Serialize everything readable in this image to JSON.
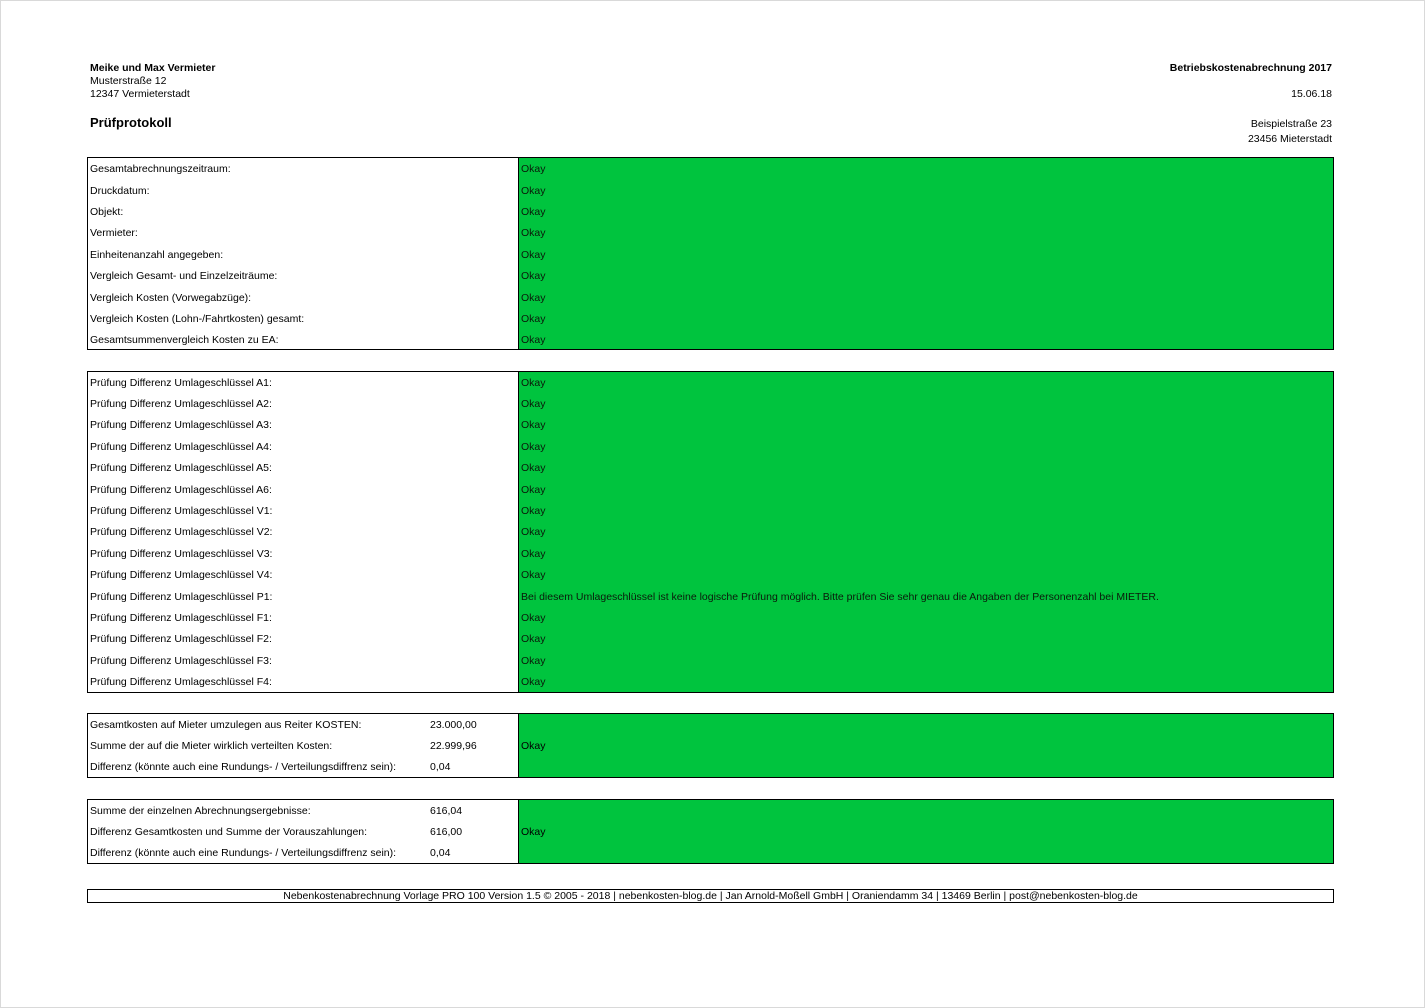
{
  "header": {
    "sender_name": "Meike und Max Vermieter",
    "sender_street": "Musterstraße 12",
    "sender_city": "12347 Vermieterstadt",
    "doc_title": "Betriebskostenabrechnung 2017",
    "doc_date": "15.06.18",
    "heading": "Prüfprotokoll",
    "recipient_street": "Beispielstraße 23",
    "recipient_city": "23456 Mieterstadt"
  },
  "section1": {
    "rows": [
      {
        "label": "Gesamtabrechnungszeitraum:",
        "status": "Okay"
      },
      {
        "label": "Druckdatum:",
        "status": "Okay"
      },
      {
        "label": "Objekt:",
        "status": "Okay"
      },
      {
        "label": "Vermieter:",
        "status": "Okay"
      },
      {
        "label": "Einheitenanzahl angegeben:",
        "status": "Okay"
      },
      {
        "label": "Vergleich Gesamt- und Einzelzeiträume:",
        "status": "Okay"
      },
      {
        "label": "Vergleich Kosten (Vorwegabzüge):",
        "status": "Okay"
      },
      {
        "label": "Vergleich Kosten (Lohn-/Fahrtkosten) gesamt:",
        "status": "Okay"
      },
      {
        "label": "Gesamtsummenvergleich Kosten zu EA:",
        "status": "Okay"
      }
    ]
  },
  "section2": {
    "rows": [
      {
        "label": "Prüfung Differenz Umlageschlüssel A1:",
        "status": "Okay"
      },
      {
        "label": "Prüfung Differenz Umlageschlüssel A2:",
        "status": "Okay"
      },
      {
        "label": "Prüfung Differenz Umlageschlüssel A3:",
        "status": "Okay"
      },
      {
        "label": "Prüfung Differenz Umlageschlüssel A4:",
        "status": "Okay"
      },
      {
        "label": "Prüfung Differenz Umlageschlüssel A5:",
        "status": "Okay"
      },
      {
        "label": "Prüfung Differenz Umlageschlüssel A6:",
        "status": "Okay"
      },
      {
        "label": "Prüfung Differenz Umlageschlüssel V1:",
        "status": "Okay"
      },
      {
        "label": "Prüfung Differenz Umlageschlüssel V2:",
        "status": "Okay"
      },
      {
        "label": "Prüfung Differenz Umlageschlüssel V3:",
        "status": "Okay"
      },
      {
        "label": "Prüfung Differenz Umlageschlüssel V4:",
        "status": "Okay"
      },
      {
        "label": "Prüfung Differenz Umlageschlüssel P1:",
        "status": "Bei diesem Umlageschlüssel ist keine logische Prüfung möglich. Bitte prüfen Sie sehr genau die Angaben der Personenzahl bei MIETER."
      },
      {
        "label": "Prüfung Differenz Umlageschlüssel F1:",
        "status": "Okay"
      },
      {
        "label": "Prüfung Differenz Umlageschlüssel F2:",
        "status": "Okay"
      },
      {
        "label": "Prüfung Differenz Umlageschlüssel F3:",
        "status": "Okay"
      },
      {
        "label": "Prüfung Differenz Umlageschlüssel F4:",
        "status": "Okay"
      }
    ]
  },
  "section3": {
    "rows": [
      {
        "label": "Gesamtkosten auf Mieter umzulegen aus Reiter KOSTEN:",
        "value": "23.000,00"
      },
      {
        "label": "Summe der auf die Mieter wirklich verteilten Kosten:",
        "value": "22.999,96"
      },
      {
        "label": "Differenz (könnte auch eine Rundungs- / Verteilungsdiffrenz sein):",
        "value": "0,04"
      }
    ],
    "status": "Okay"
  },
  "section4": {
    "rows": [
      {
        "label": "Summe der einzelnen Abrechnungsergebnisse:",
        "value": "616,04"
      },
      {
        "label": "Differenz Gesamtkosten und Summe der Vorauszahlungen:",
        "value": "616,00"
      },
      {
        "label": "Differenz (könnte auch eine Rundungs- / Verteilungsdiffrenz sein):",
        "value": "0,04"
      }
    ],
    "status": "Okay"
  },
  "footer": {
    "text": "Nebenkostenabrechnung Vorlage PRO 100 Version 1.5 © 2005 - 2018 | nebenkosten-blog.de | Jan Arnold-Moßell GmbH | Oraniendamm 34 | 13469 Berlin | post@nebenkosten-blog.de"
  }
}
